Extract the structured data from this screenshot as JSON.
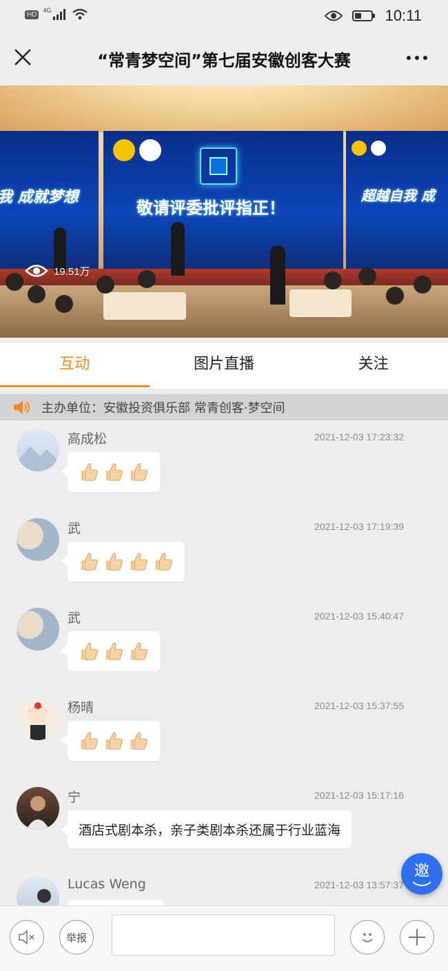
{
  "status_bar": {
    "hd": "HD",
    "network": "4G",
    "time": "10:11"
  },
  "nav": {
    "title": "“常青梦空间”第七届安徽创客大赛"
  },
  "banner": {
    "views": "19.51万",
    "screen_main_text": "敬请评委批评指正！",
    "screen_left_text": "我 成就梦想",
    "screen_right_text": "超越自我 成"
  },
  "tabs": [
    {
      "label": "互动",
      "active": true
    },
    {
      "label": "图片直播",
      "active": false
    },
    {
      "label": "关注",
      "active": false
    }
  ],
  "notice": {
    "text": "主办单位：安徽投资俱乐部 常青创客·梦空间"
  },
  "messages": [
    {
      "name": "高成松",
      "time": "2021-12-03 17:23:32",
      "thumbs": 3
    },
    {
      "name": "武",
      "time": "2021-12-03 17:19:39",
      "thumbs": 4
    },
    {
      "name": "武",
      "time": "2021-12-03 15:40:47",
      "thumbs": 3
    },
    {
      "name": "杨晴",
      "time": "2021-12-03 15:37:55",
      "thumbs": 3
    },
    {
      "name": "宁",
      "time": "2021-12-03 15:17:16",
      "text": "酒店式剧本杀，亲子类剧本杀还属于行业蓝海"
    },
    {
      "name": "Lucas Weng",
      "time": "2021-12-03 13:57:37"
    }
  ],
  "fab": {
    "label": "邀"
  },
  "bottom": {
    "report_label": "举报",
    "input_value": ""
  },
  "colors": {
    "accent": "#f08c1e",
    "fab": "#2e6ff0"
  }
}
